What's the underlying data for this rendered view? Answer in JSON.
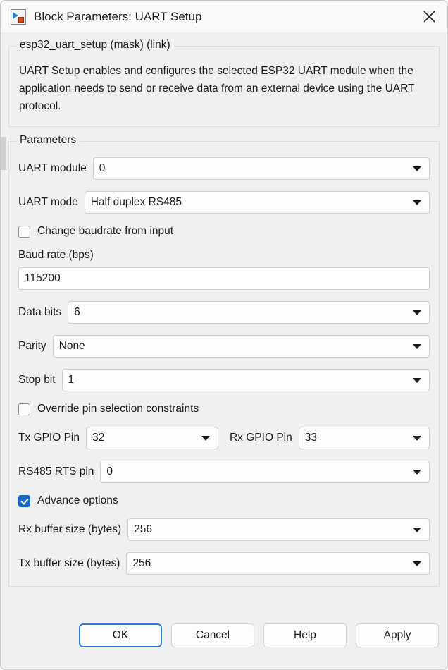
{
  "window": {
    "title": "Block Parameters: UART Setup",
    "icon": "simulink-block-icon",
    "close_label": "✕"
  },
  "description": {
    "legend": "esp32_uart_setup (mask) (link)",
    "text": "UART Setup enables and configures the selected ESP32 UART module when the application needs to send or receive data from an external device using the UART protocol."
  },
  "parameters": {
    "legend": "Parameters",
    "uart_module": {
      "label": "UART module",
      "value": "0"
    },
    "uart_mode": {
      "label": "UART mode",
      "value": "Half duplex RS485"
    },
    "change_baudrate": {
      "label": "Change baudrate from input",
      "checked": "off"
    },
    "baud_rate": {
      "label": "Baud rate (bps)",
      "value": "115200"
    },
    "data_bits": {
      "label": "Data bits",
      "value": "6"
    },
    "parity": {
      "label": "Parity",
      "value": "None"
    },
    "stop_bit": {
      "label": "Stop bit",
      "value": "1"
    },
    "override_pins": {
      "label": "Override pin selection constraints",
      "checked": "off"
    },
    "tx_gpio_pin": {
      "label": "Tx GPIO Pin",
      "value": "32"
    },
    "rx_gpio_pin": {
      "label": "Rx GPIO Pin",
      "value": "33"
    },
    "rs485_rts_pin": {
      "label": "RS485 RTS pin",
      "value": "0"
    },
    "advance_options": {
      "label": "Advance options",
      "checked": "on"
    },
    "rx_buffer_size": {
      "label": "Rx buffer size (bytes)",
      "value": "256"
    },
    "tx_buffer_size": {
      "label": "Tx buffer size (bytes)",
      "value": "256"
    }
  },
  "footer": {
    "ok": "OK",
    "cancel": "Cancel",
    "help": "Help",
    "apply": "Apply"
  },
  "colors": {
    "accent": "#1668c8",
    "focus_border": "#2a7fd4",
    "dialog_bg": "#f0f0f0",
    "titlebar_bg": "#f9f9f9",
    "field_bg": "#fdfdfd",
    "text": "#1a1a1a"
  }
}
